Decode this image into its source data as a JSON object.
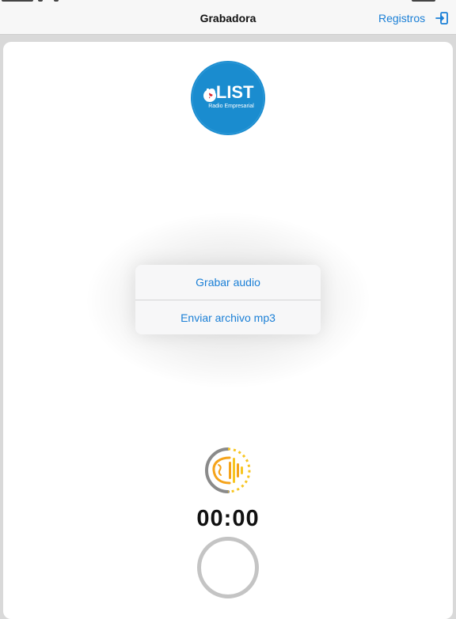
{
  "navbar": {
    "title": "Grabadora",
    "right_label": "Registros",
    "right_icon": "logout-icon"
  },
  "logo": {
    "brand_text": "pLIST",
    "sub_text": "Radio Empresarial",
    "color": "#1a8ccf"
  },
  "action_sheet": {
    "items": [
      {
        "label": "Grabar audio"
      },
      {
        "label": "Enviar archivo mp3"
      }
    ]
  },
  "recorder": {
    "icon": "audio-wave-icon",
    "timer": "00:00",
    "record_button_icon": "record-ring-icon"
  },
  "colors": {
    "accent": "#1a7fd6",
    "icon_orange": "#f5a31a",
    "icon_yellow": "#f7c520",
    "ring_gray": "#c4c4c4"
  }
}
